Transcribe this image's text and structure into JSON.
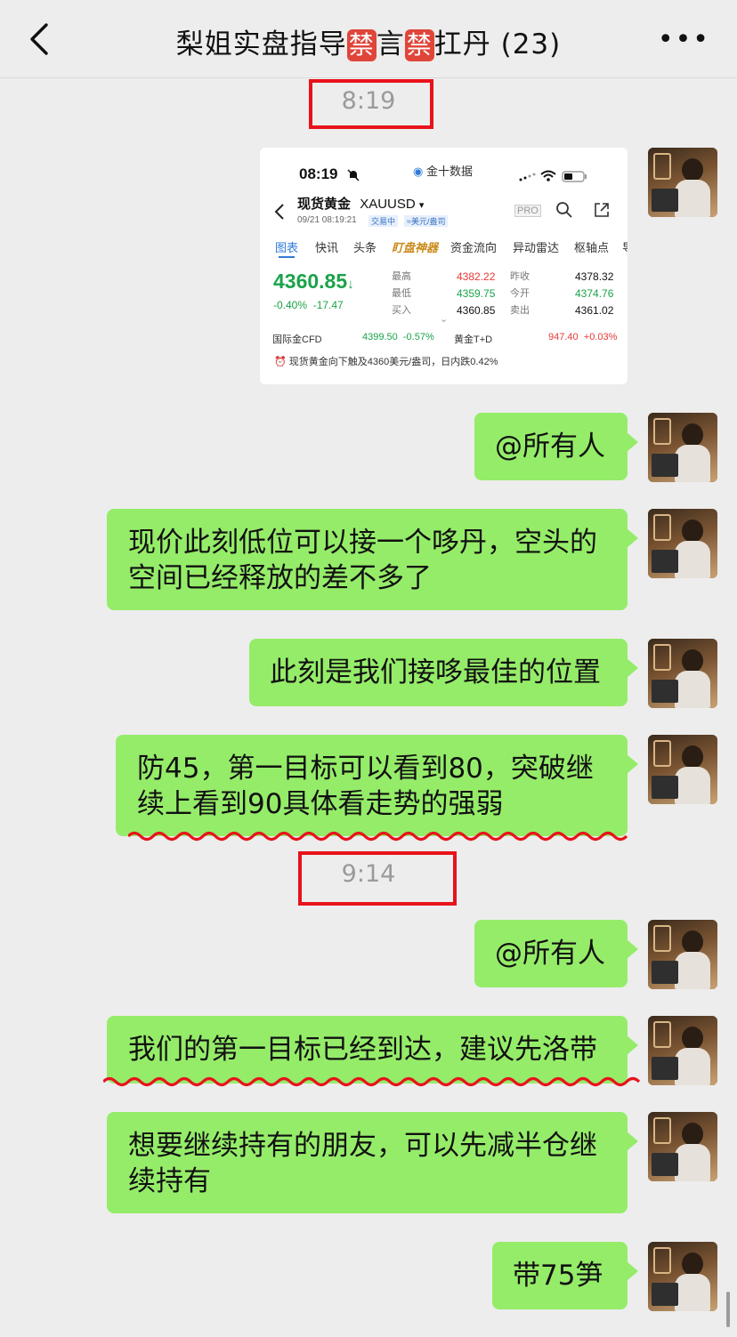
{
  "header": {
    "title_part1": "梨姐实盘指导",
    "ban1": "禁",
    "title_part2": "言",
    "ban2": "禁",
    "title_part3": "扛丹 (23)",
    "more": "•••"
  },
  "timestamps": [
    "8:19",
    "9:14"
  ],
  "quote_card": {
    "status_time": "08:19",
    "app_name": "金十数据",
    "instrument": "现货黄金",
    "symbol": "XAUUSD",
    "datetime": "09/21 08:19:21",
    "trading_badge": "交易中",
    "unit_badge": "≈美元/盎司",
    "pro_badge": "PRO",
    "tabs": [
      "图表",
      "快讯",
      "头条",
      "盯盘神器",
      "资金流向",
      "异动雷达",
      "枢轴点",
      "导"
    ],
    "price": "4360.85",
    "price_arrow": "↓",
    "change_pct": "-0.40%",
    "change_abs": "-17.47",
    "stats_col1": [
      {
        "label": "最高",
        "value": "4382.22"
      },
      {
        "label": "最低",
        "value": "4359.75"
      },
      {
        "label": "买入",
        "value": "4360.85"
      }
    ],
    "stats_col2": [
      {
        "label": "昨收",
        "value": "4378.32"
      },
      {
        "label": "今开",
        "value": "4374.76"
      },
      {
        "label": "卖出",
        "value": "4361.02"
      }
    ],
    "caret": "⌄",
    "cfd_label": "国际金CFD",
    "cfd_value": "4399.50",
    "cfd_change": "-0.57%",
    "td_label": "黄金T+D",
    "td_value": "947.40",
    "td_change": "+0.03%",
    "alert_icon": "⏰",
    "alert_text": "现货黄金向下触及4360美元/盎司，日内跌0.42%"
  },
  "messages": [
    {
      "lines": [
        "@所有人"
      ]
    },
    {
      "lines": [
        "现价此刻低位可以接一个哆丹，空头的",
        "空间已经释放的差不多了"
      ]
    },
    {
      "lines": [
        "此刻是我们接哆最佳的位置"
      ]
    },
    {
      "lines": [
        "防45，第一目标可以看到80，突破继",
        "续上看到90具体看走势的强弱"
      ]
    },
    {
      "lines": [
        "@所有人"
      ]
    },
    {
      "lines": [
        "我们的第一目标已经到达，建议先洛带"
      ]
    },
    {
      "lines": [
        "想要继续持有的朋友，可以先减半仓继",
        "续持有"
      ]
    },
    {
      "lines": [
        "带75笋"
      ]
    }
  ],
  "colors": {
    "bubble": "#95ec69",
    "background": "#ededed",
    "annotation_red": "#e8121b",
    "price_green": "#1aa34a",
    "price_red": "#e53935"
  }
}
